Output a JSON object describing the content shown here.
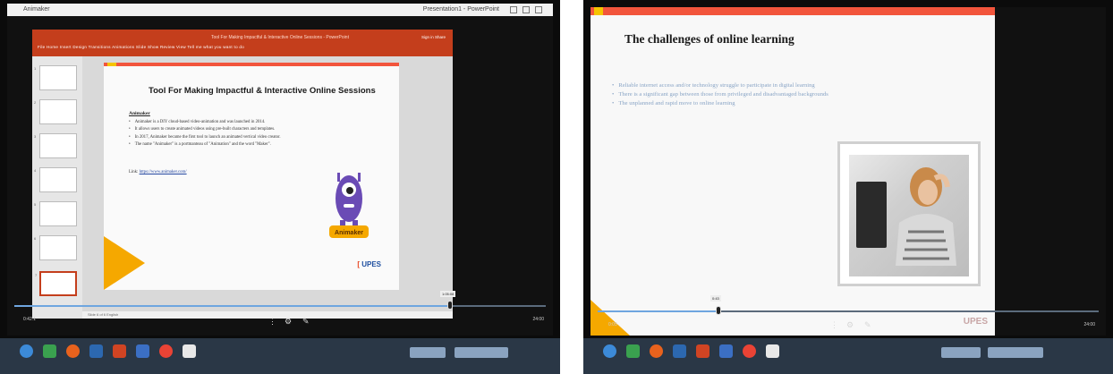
{
  "left": {
    "window_title": "Animaker",
    "window_title_right": "Presentation1 - PowerPoint",
    "ppt": {
      "ribbon_title": "Tool For Making Impactful & Interactive Online Sessions - PowerPoint",
      "ribbon_tabs": "File  Home  Insert  Design  Transitions  Animations  Slide Show  Review  View  Tell me what you want to do",
      "user": "Sign in  Share",
      "status": "Slide 6 of 6  English"
    },
    "slide": {
      "title": "Tool For Making Impactful & Interactive Online Sessions",
      "intro_heading": "Animaker",
      "bullets": [
        "Animaker is a DIY cloud-based video-animation and was launched in 2014.",
        "It allows users to create animated videos using pre-built characters and templates.",
        "In 2017, Animaker became the first tool to launch an animated vertical video creator.",
        "The name \"Animaker\" is a portmanteau of \"Animation\" and the word \"Maker\"."
      ],
      "link_label": "Link:",
      "link_url": "https://www.animaker.com/",
      "mascot_label": "Animaker",
      "logo_text": "UPES"
    },
    "player": {
      "time_left": "0:42:1",
      "time_right": "24:00",
      "tooltip": "1:05:08",
      "progress": 0.82
    }
  },
  "right": {
    "slide": {
      "title": "The challenges of online learning",
      "bullets": [
        "Reliable internet access and/or technology struggle to participate in digital learning",
        "There is a significant gap between those from privileged and disadvantaged backgrounds",
        "The unplanned and rapid move to online learning"
      ],
      "logo_text": "UPES"
    },
    "player": {
      "time_left": "0:05",
      "time_right": "24:00",
      "tooltip": "0:43",
      "progress": 0.24
    }
  },
  "icons": [
    "windows-start-icon",
    "search-icon",
    "firefox-icon",
    "explorer-icon",
    "powerpoint-icon",
    "word-icon",
    "chrome-icon",
    "app-icon"
  ],
  "colors": {
    "ribbon": "#c43e1c",
    "accent_red": "#f2553c",
    "accent_yellow": "#f5a800",
    "taskbar": "#2a3746",
    "bullet_blue": "#8aa5c6"
  }
}
